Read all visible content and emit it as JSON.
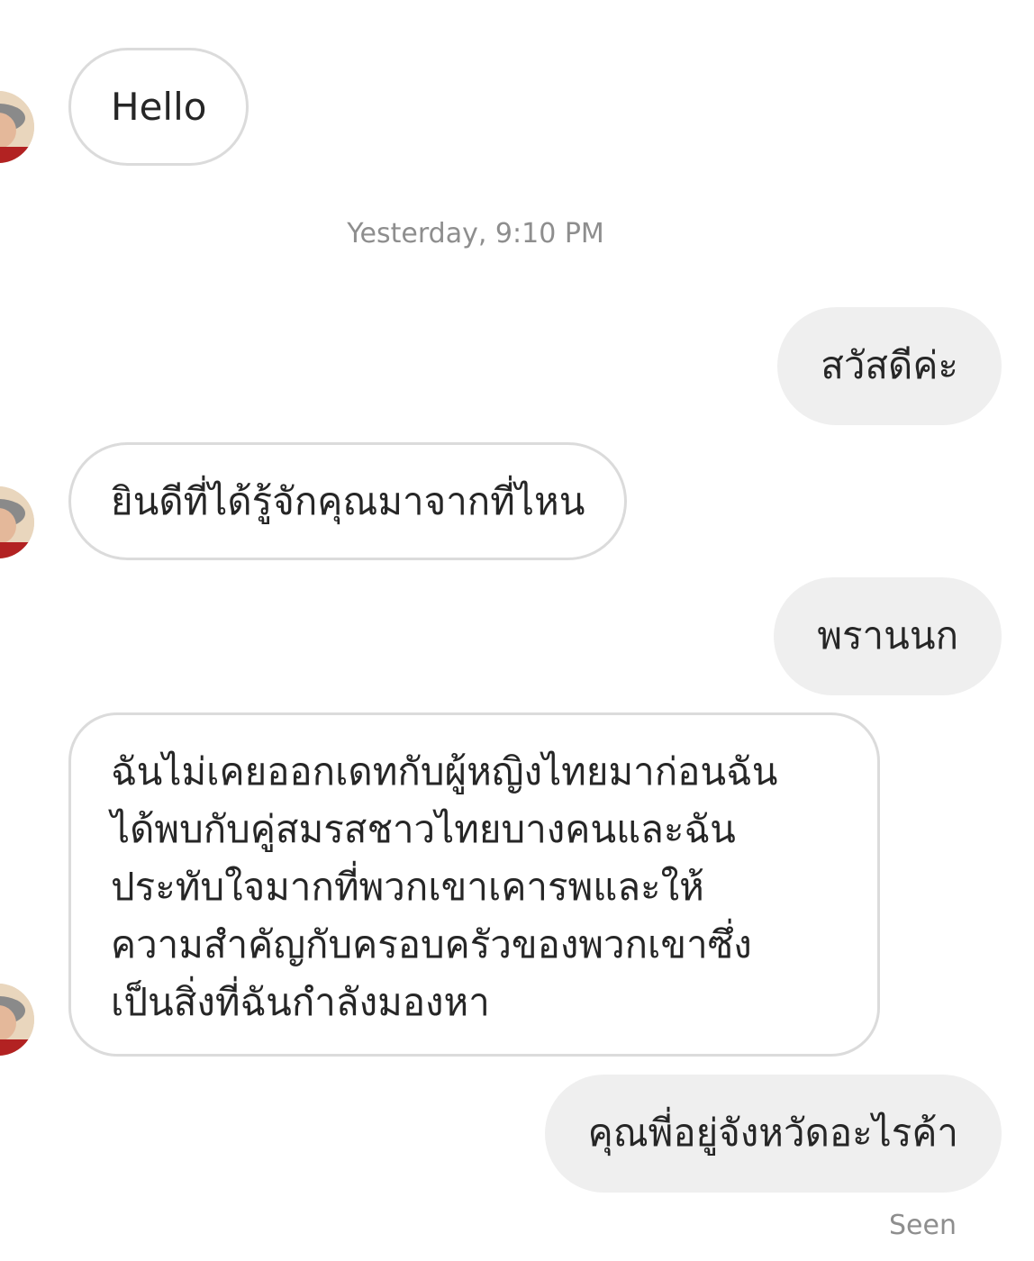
{
  "conversation": {
    "messages": [
      {
        "sender": "them",
        "text": "Hello"
      },
      {
        "sender": "me",
        "text": "สวัสดีค่ะ"
      },
      {
        "sender": "them",
        "text": "ยินดีที่ได้รู้จักคุณมาจากที่ไหน"
      },
      {
        "sender": "me",
        "text": "พรานนก"
      },
      {
        "sender": "them",
        "lines": [
          "ฉันไม่เคยออกเดทกับผู้หญิงไทยมาก่อนฉัน",
          "ได้พบกับคู่สมรสชาวไทยบางคนและฉัน",
          "ประทับใจมากที่พวกเขาเคารพและให้",
          "ความสำคัญกับครอบครัวของพวกเขาซึ่ง",
          "เป็นสิ่งที่ฉันกำลังมองหา"
        ]
      },
      {
        "sender": "me",
        "text": "คุณพี่อยู่จังหวัดอะไรค้า"
      }
    ],
    "timestamp": "Yesterday, 9:10 PM",
    "status": "Seen"
  },
  "colors": {
    "incoming_border": "#dbdbdb",
    "outgoing_bg": "#efefef",
    "text": "#262626",
    "meta_text": "#8e8e8e"
  },
  "icons": {
    "avatar": "user-avatar-icon"
  }
}
